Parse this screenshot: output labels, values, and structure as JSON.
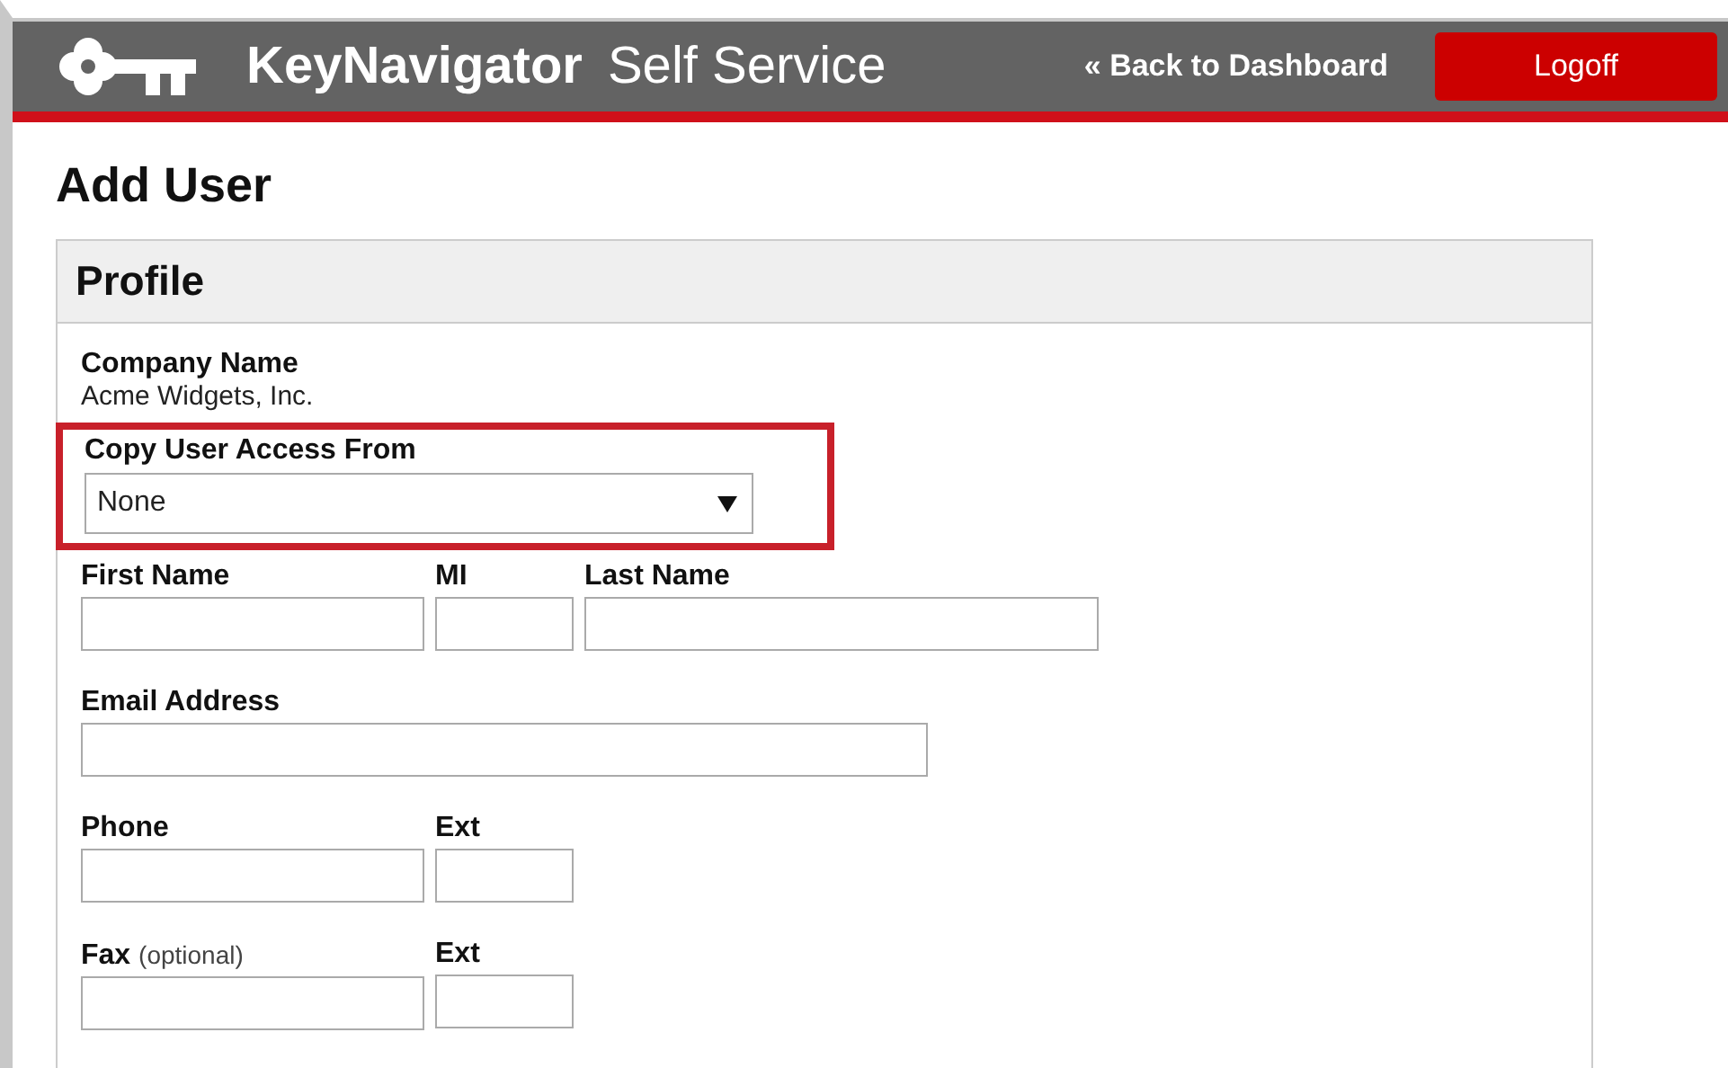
{
  "header": {
    "brand": "KeyNavigator",
    "subtitle": "Self Service",
    "back_link": "« Back to Dashboard",
    "logoff": "Logoff"
  },
  "page_title": "Add User",
  "panel": {
    "title": "Profile",
    "company_label": "Company Name",
    "company_value": "Acme Widgets, Inc.",
    "copy_access": {
      "label": "Copy User Access From",
      "value": "None",
      "highlighted": true
    },
    "rows": [
      [
        {
          "label": "First Name",
          "kind": "medium"
        },
        {
          "label": "MI",
          "kind": "short"
        },
        {
          "label": "Last Name",
          "kind": "long"
        }
      ],
      [
        {
          "label": "Email Address",
          "kind": "wide"
        }
      ],
      [
        {
          "label": "Phone",
          "kind": "medium"
        },
        {
          "label": "Ext",
          "kind": "short"
        }
      ],
      [
        {
          "label": "Fax",
          "note": "(optional)",
          "kind": "medium"
        },
        {
          "label": "Ext",
          "kind": "short"
        }
      ]
    ]
  }
}
